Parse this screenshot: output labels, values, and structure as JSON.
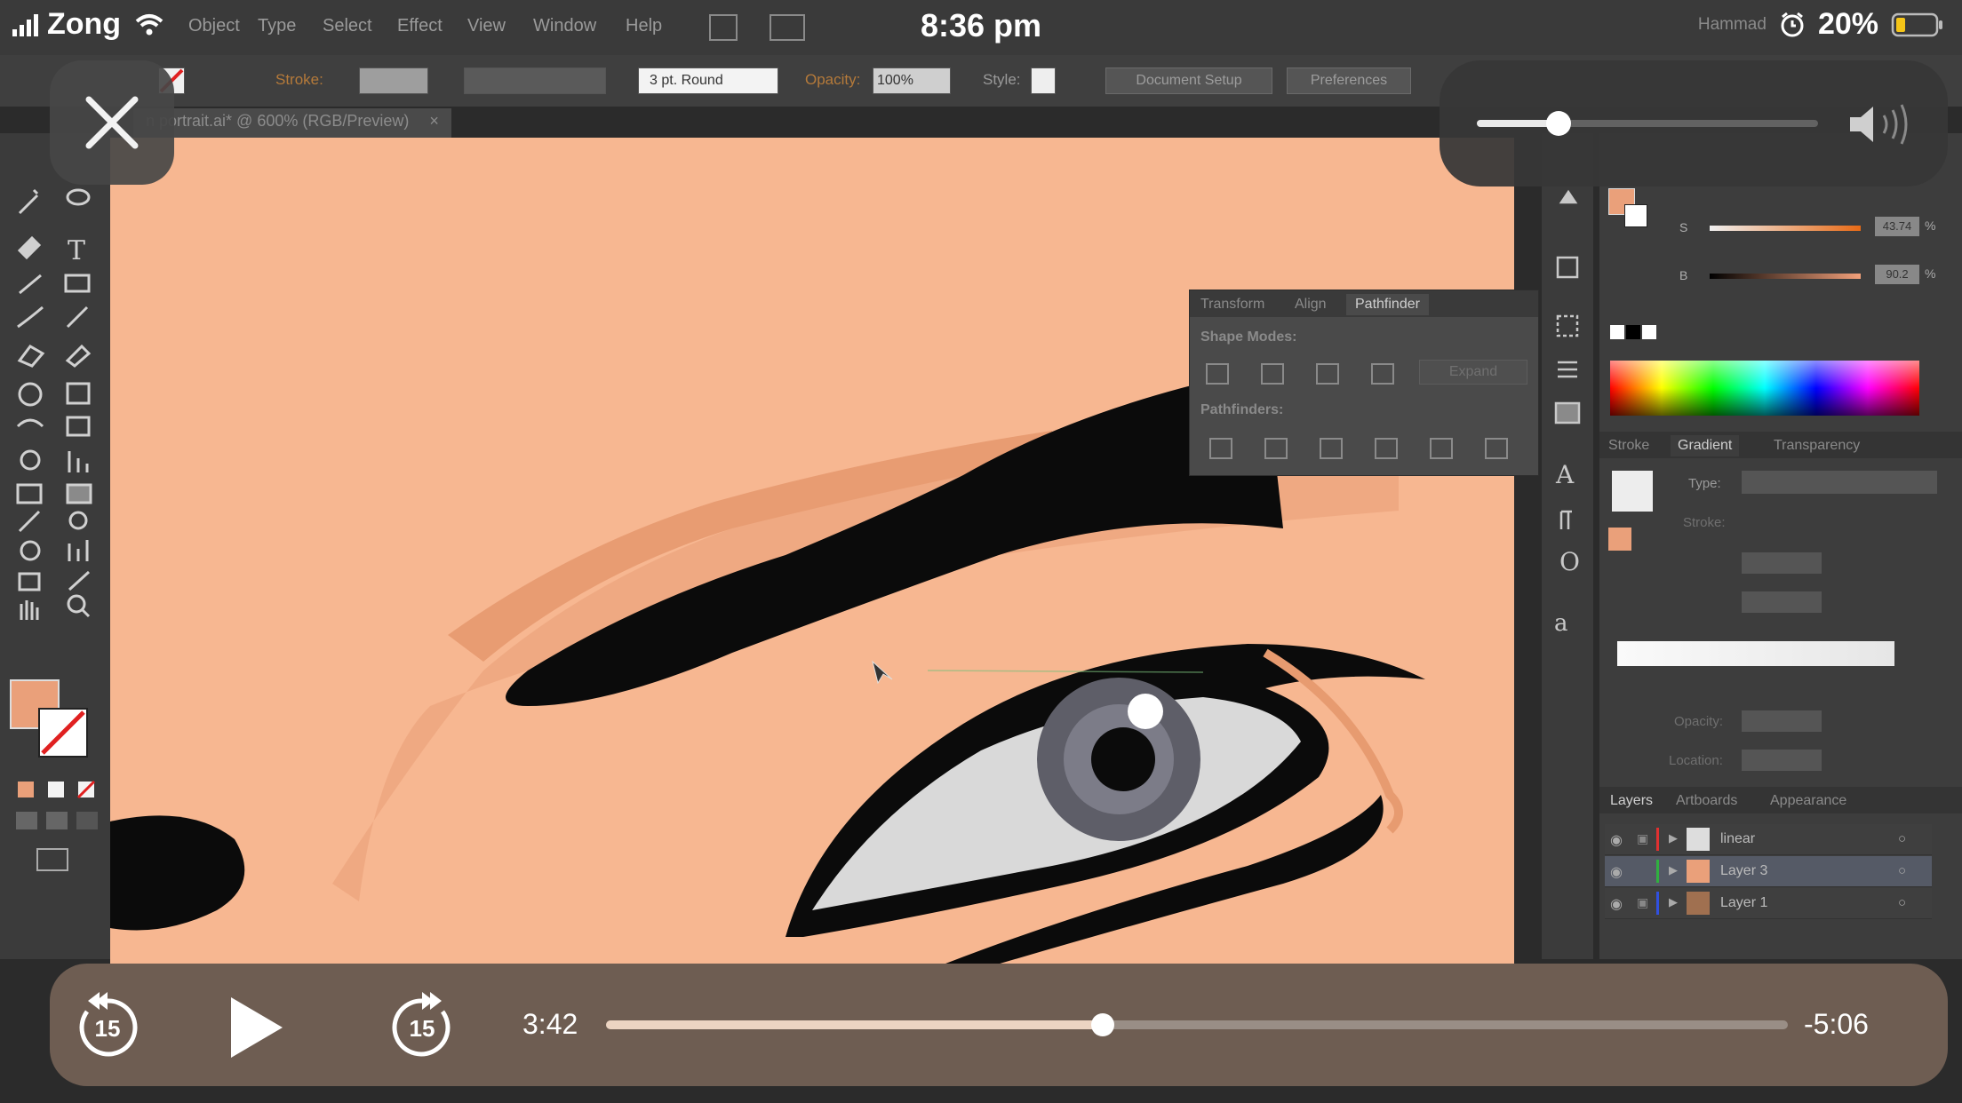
{
  "status_bar": {
    "carrier": "Zong",
    "time": "8:36 pm",
    "user": "Hammad",
    "battery": "20%"
  },
  "menu": [
    "Object",
    "Type",
    "Select",
    "Effect",
    "View",
    "Window",
    "Help"
  ],
  "control_bar": {
    "stroke_label": "Stroke:",
    "brush": "3 pt. Round",
    "opacity_label": "Opacity:",
    "opacity_value": "100%",
    "style_label": "Style:",
    "document_setup": "Document Setup",
    "preferences": "Preferences"
  },
  "document_tab": "n portrait.ai* @ 600% (RGB/Preview)",
  "pathfinder_panel": {
    "tabs": [
      "Transform",
      "Align",
      "Pathfinder"
    ],
    "shape_modes": "Shape Modes:",
    "expand": "Expand",
    "pathfinders": "Pathfinders:"
  },
  "color_panel": {
    "s_label": "S",
    "s_value": "43.74",
    "b_label": "B",
    "b_value": "90.2",
    "unit": "%"
  },
  "gradient_panel": {
    "tabs": [
      "Stroke",
      "Gradient",
      "Transparency"
    ],
    "type_label": "Type:",
    "stroke_label": "Stroke:",
    "opacity_label": "Opacity:",
    "location_label": "Location:"
  },
  "layers_panel": {
    "tabs": [
      "Layers",
      "Artboards",
      "Appearance"
    ],
    "layers": [
      {
        "name": "linear",
        "color": "#e03030"
      },
      {
        "name": "Layer 3",
        "color": "#30b040"
      },
      {
        "name": "Layer 1",
        "color": "#3050e0"
      }
    ]
  },
  "playback": {
    "elapsed": "3:42",
    "remaining": "-5:06",
    "progress_fraction": 0.42,
    "skip_back": "15",
    "skip_forward": "15"
  },
  "volume_fraction": 0.24,
  "colors": {
    "skin": "#f7b791",
    "skin_shadow": "#e9a274",
    "hair": "#0b0b0b",
    "accent_orange": "#b57a3a"
  }
}
